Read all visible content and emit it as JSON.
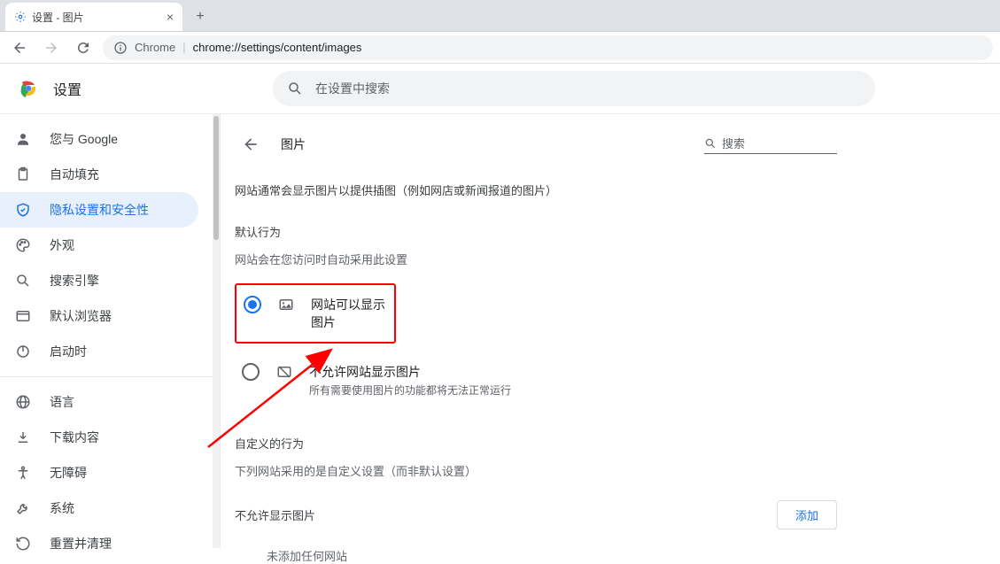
{
  "tab": {
    "title": "设置 - 图片"
  },
  "omnibox": {
    "scheme": "Chrome",
    "path": "chrome://settings/content/images"
  },
  "header": {
    "title": "设置",
    "search_placeholder": "在设置中搜索"
  },
  "sidebar": {
    "items": [
      {
        "id": "you-and-google",
        "label": "您与 Google",
        "icon": "person"
      },
      {
        "id": "autofill",
        "label": "自动填充",
        "icon": "clipboard"
      },
      {
        "id": "privacy",
        "label": "隐私设置和安全性",
        "icon": "shield",
        "active": true
      },
      {
        "id": "appearance",
        "label": "外观",
        "icon": "palette"
      },
      {
        "id": "search-engine",
        "label": "搜索引擎",
        "icon": "search"
      },
      {
        "id": "default-browser",
        "label": "默认浏览器",
        "icon": "browser"
      },
      {
        "id": "on-startup",
        "label": "启动时",
        "icon": "power"
      },
      {
        "id": "languages",
        "label": "语言",
        "icon": "globe"
      },
      {
        "id": "downloads",
        "label": "下载内容",
        "icon": "download"
      },
      {
        "id": "accessibility",
        "label": "无障碍",
        "icon": "accessibility"
      },
      {
        "id": "system",
        "label": "系统",
        "icon": "wrench"
      },
      {
        "id": "reset",
        "label": "重置并清理",
        "icon": "restore"
      }
    ]
  },
  "content": {
    "back_label": "返回",
    "title": "图片",
    "search_label": "搜索",
    "description": "网站通常会显示图片以提供插图（例如网店或新闻报道的图片）",
    "default_behavior_title": "默认行为",
    "default_behavior_sub": "网站会在您访问时自动采用此设置",
    "options": [
      {
        "id": "allow",
        "label": "网站可以显示图片",
        "checked": true
      },
      {
        "id": "block",
        "label": "不允许网站显示图片",
        "sub": "所有需要使用图片的功能都将无法正常运行",
        "checked": false
      }
    ],
    "custom_title": "自定义的行为",
    "custom_sub": "下列网站采用的是自定义设置（而非默认设置）",
    "block_section_title": "不允许显示图片",
    "add_button": "添加",
    "empty_text": "未添加任何网站"
  }
}
